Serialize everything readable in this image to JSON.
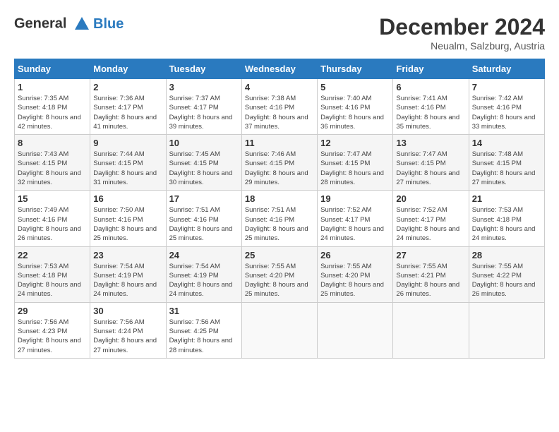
{
  "header": {
    "logo_line1": "General",
    "logo_line2": "Blue",
    "title": "December 2024",
    "location": "Neualm, Salzburg, Austria"
  },
  "calendar": {
    "days_of_week": [
      "Sunday",
      "Monday",
      "Tuesday",
      "Wednesday",
      "Thursday",
      "Friday",
      "Saturday"
    ],
    "weeks": [
      [
        null,
        {
          "day": "2",
          "sunrise": "7:36 AM",
          "sunset": "4:17 PM",
          "daylight": "8 hours and 41 minutes."
        },
        {
          "day": "3",
          "sunrise": "7:37 AM",
          "sunset": "4:17 PM",
          "daylight": "8 hours and 39 minutes."
        },
        {
          "day": "4",
          "sunrise": "7:38 AM",
          "sunset": "4:16 PM",
          "daylight": "8 hours and 37 minutes."
        },
        {
          "day": "5",
          "sunrise": "7:40 AM",
          "sunset": "4:16 PM",
          "daylight": "8 hours and 36 minutes."
        },
        {
          "day": "6",
          "sunrise": "7:41 AM",
          "sunset": "4:16 PM",
          "daylight": "8 hours and 35 minutes."
        },
        {
          "day": "7",
          "sunrise": "7:42 AM",
          "sunset": "4:16 PM",
          "daylight": "8 hours and 33 minutes."
        }
      ],
      [
        {
          "day": "1",
          "sunrise": "7:35 AM",
          "sunset": "4:18 PM",
          "daylight": "8 hours and 42 minutes."
        },
        null,
        null,
        null,
        null,
        null,
        null
      ],
      [
        {
          "day": "8",
          "sunrise": "7:43 AM",
          "sunset": "4:15 PM",
          "daylight": "8 hours and 32 minutes."
        },
        {
          "day": "9",
          "sunrise": "7:44 AM",
          "sunset": "4:15 PM",
          "daylight": "8 hours and 31 minutes."
        },
        {
          "day": "10",
          "sunrise": "7:45 AM",
          "sunset": "4:15 PM",
          "daylight": "8 hours and 30 minutes."
        },
        {
          "day": "11",
          "sunrise": "7:46 AM",
          "sunset": "4:15 PM",
          "daylight": "8 hours and 29 minutes."
        },
        {
          "day": "12",
          "sunrise": "7:47 AM",
          "sunset": "4:15 PM",
          "daylight": "8 hours and 28 minutes."
        },
        {
          "day": "13",
          "sunrise": "7:47 AM",
          "sunset": "4:15 PM",
          "daylight": "8 hours and 27 minutes."
        },
        {
          "day": "14",
          "sunrise": "7:48 AM",
          "sunset": "4:15 PM",
          "daylight": "8 hours and 27 minutes."
        }
      ],
      [
        {
          "day": "15",
          "sunrise": "7:49 AM",
          "sunset": "4:16 PM",
          "daylight": "8 hours and 26 minutes."
        },
        {
          "day": "16",
          "sunrise": "7:50 AM",
          "sunset": "4:16 PM",
          "daylight": "8 hours and 25 minutes."
        },
        {
          "day": "17",
          "sunrise": "7:51 AM",
          "sunset": "4:16 PM",
          "daylight": "8 hours and 25 minutes."
        },
        {
          "day": "18",
          "sunrise": "7:51 AM",
          "sunset": "4:16 PM",
          "daylight": "8 hours and 25 minutes."
        },
        {
          "day": "19",
          "sunrise": "7:52 AM",
          "sunset": "4:17 PM",
          "daylight": "8 hours and 24 minutes."
        },
        {
          "day": "20",
          "sunrise": "7:52 AM",
          "sunset": "4:17 PM",
          "daylight": "8 hours and 24 minutes."
        },
        {
          "day": "21",
          "sunrise": "7:53 AM",
          "sunset": "4:18 PM",
          "daylight": "8 hours and 24 minutes."
        }
      ],
      [
        {
          "day": "22",
          "sunrise": "7:53 AM",
          "sunset": "4:18 PM",
          "daylight": "8 hours and 24 minutes."
        },
        {
          "day": "23",
          "sunrise": "7:54 AM",
          "sunset": "4:19 PM",
          "daylight": "8 hours and 24 minutes."
        },
        {
          "day": "24",
          "sunrise": "7:54 AM",
          "sunset": "4:19 PM",
          "daylight": "8 hours and 24 minutes."
        },
        {
          "day": "25",
          "sunrise": "7:55 AM",
          "sunset": "4:20 PM",
          "daylight": "8 hours and 25 minutes."
        },
        {
          "day": "26",
          "sunrise": "7:55 AM",
          "sunset": "4:20 PM",
          "daylight": "8 hours and 25 minutes."
        },
        {
          "day": "27",
          "sunrise": "7:55 AM",
          "sunset": "4:21 PM",
          "daylight": "8 hours and 26 minutes."
        },
        {
          "day": "28",
          "sunrise": "7:55 AM",
          "sunset": "4:22 PM",
          "daylight": "8 hours and 26 minutes."
        }
      ],
      [
        {
          "day": "29",
          "sunrise": "7:56 AM",
          "sunset": "4:23 PM",
          "daylight": "8 hours and 27 minutes."
        },
        {
          "day": "30",
          "sunrise": "7:56 AM",
          "sunset": "4:24 PM",
          "daylight": "8 hours and 27 minutes."
        },
        {
          "day": "31",
          "sunrise": "7:56 AM",
          "sunset": "4:25 PM",
          "daylight": "8 hours and 28 minutes."
        },
        null,
        null,
        null,
        null
      ]
    ],
    "labels": {
      "sunrise": "Sunrise:",
      "sunset": "Sunset:",
      "daylight": "Daylight:"
    }
  }
}
